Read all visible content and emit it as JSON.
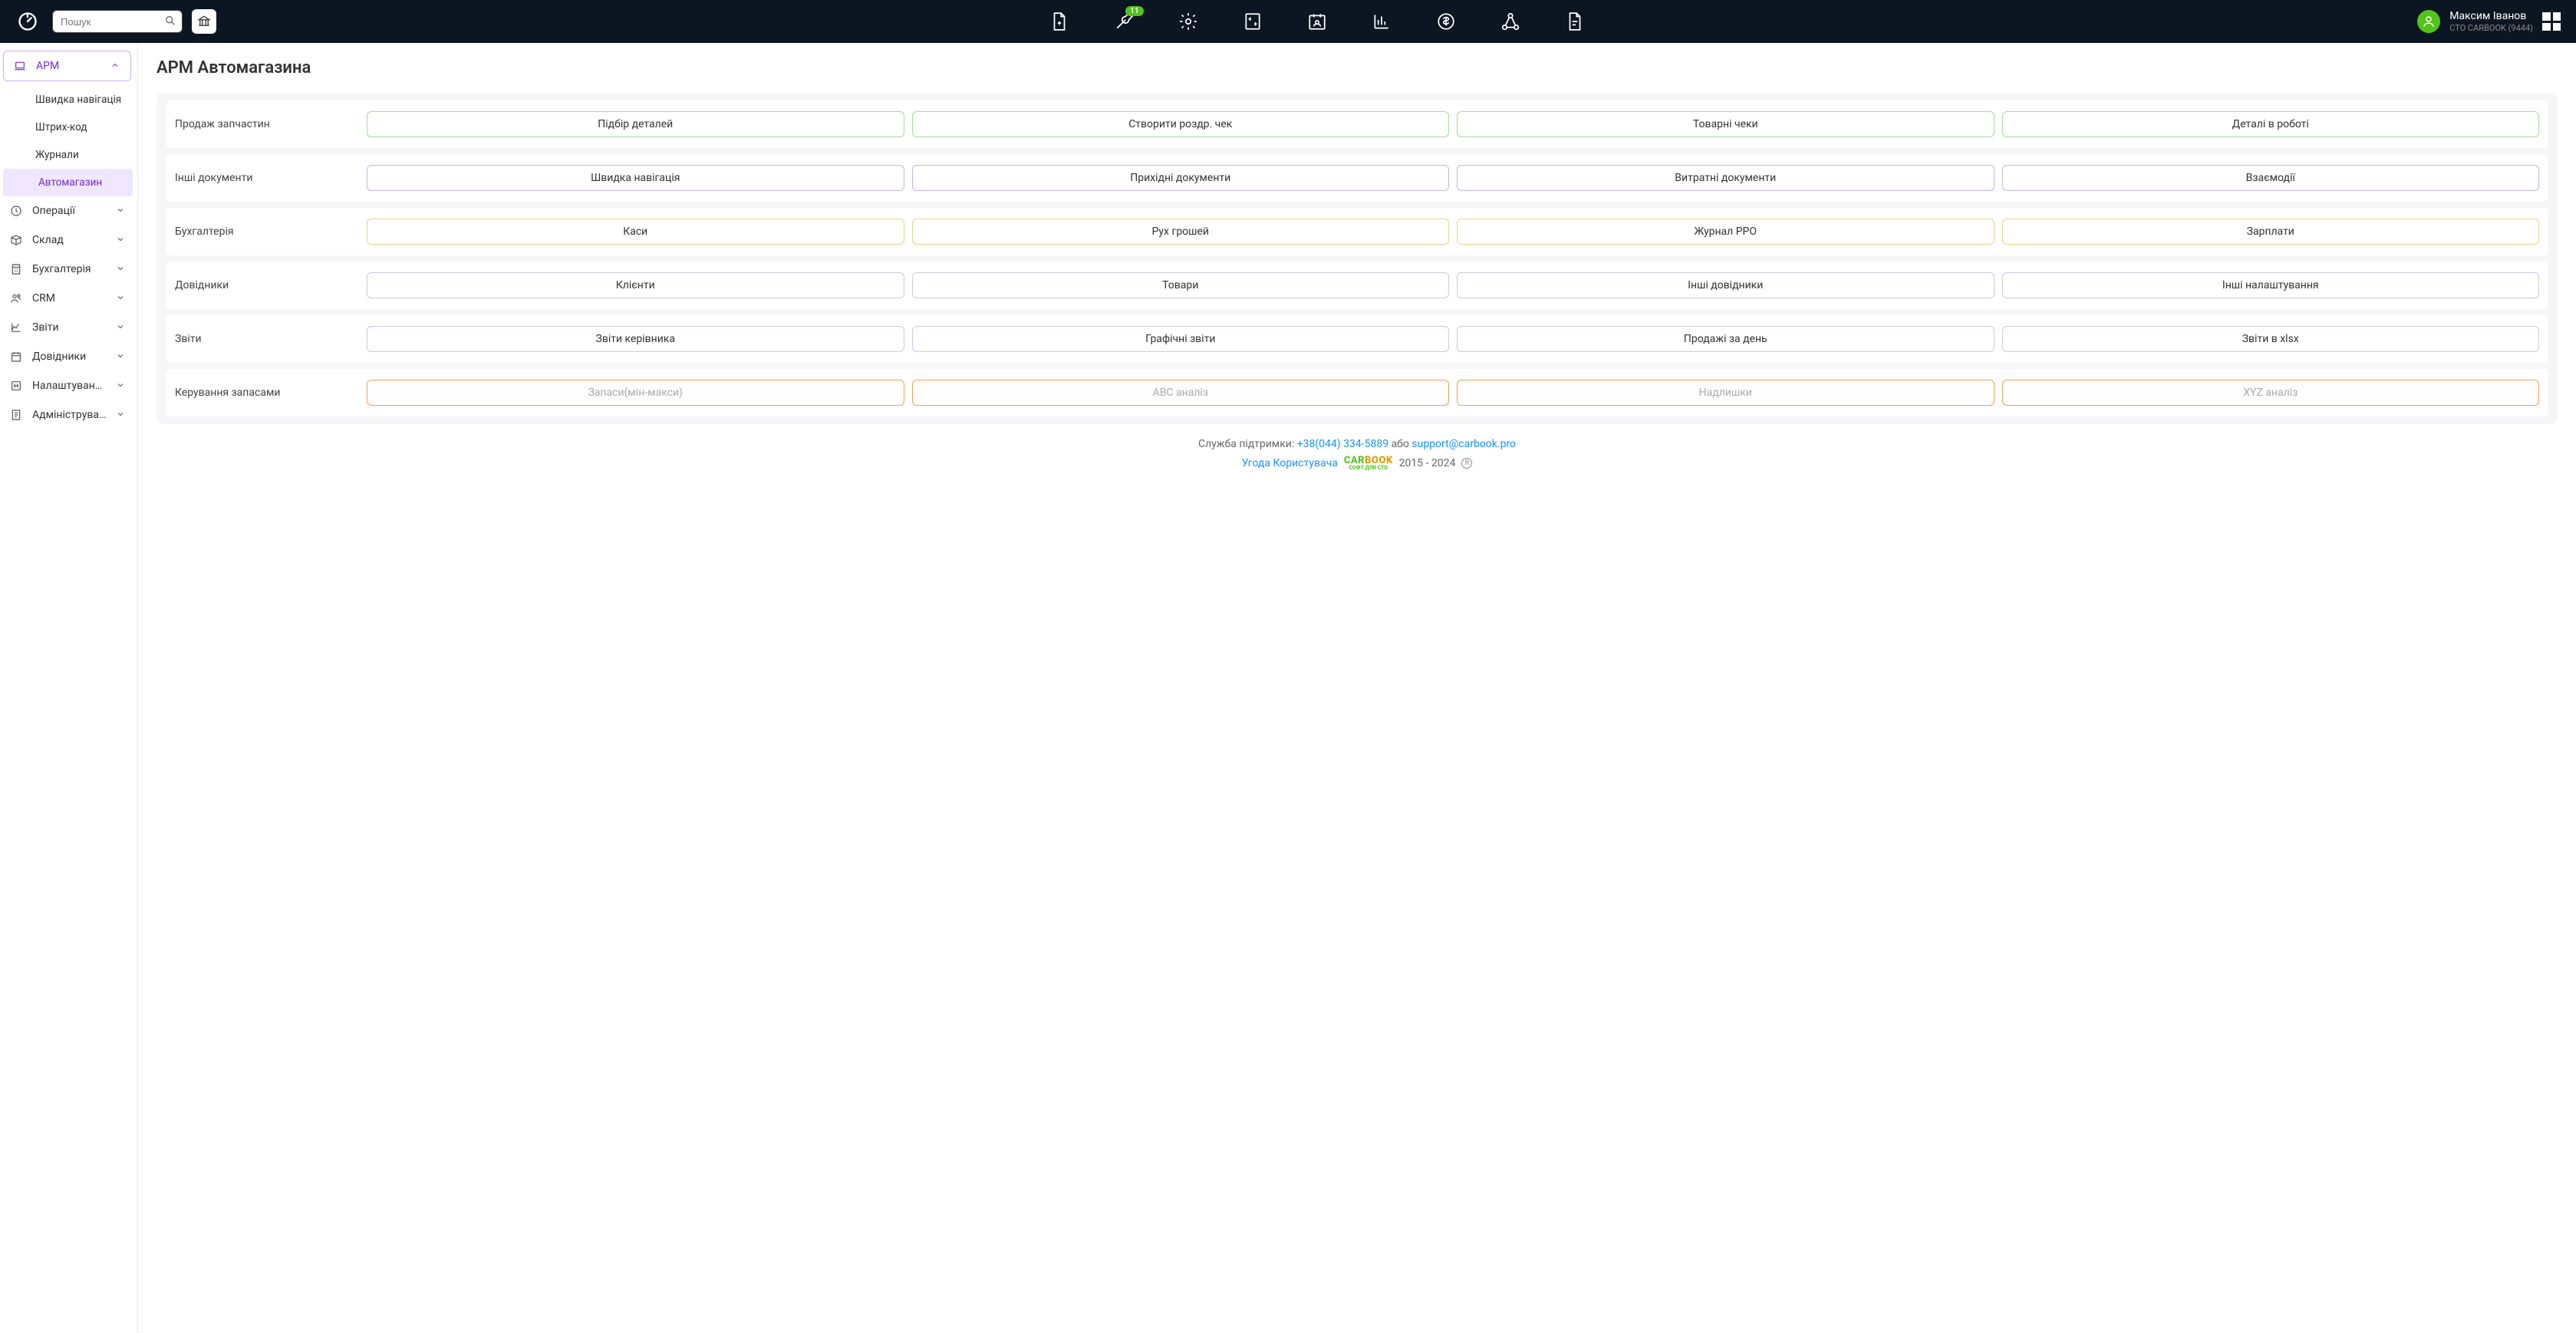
{
  "header": {
    "search_placeholder": "Пошук",
    "badge_count": "11",
    "user_name": "Максим Іванов",
    "user_org": "СТО CARBOOK (9444)"
  },
  "sidebar": {
    "arm_label": "АРМ",
    "sub_quick_nav": "Швидка навігація",
    "sub_barcode": "Штрих-код",
    "sub_journals": "Журнали",
    "sub_autoshop": "Автомагазин",
    "items": [
      {
        "label": "Операції"
      },
      {
        "label": "Склад"
      },
      {
        "label": "Бухгалтерія"
      },
      {
        "label": "CRM"
      },
      {
        "label": "Звіти"
      },
      {
        "label": "Довідники"
      },
      {
        "label": "Налаштування"
      },
      {
        "label": "Адміністрування"
      }
    ]
  },
  "page": {
    "title": "АРМ Автомагазина",
    "sections": [
      {
        "label": "Продаж запчастин",
        "cls": "b-green",
        "buttons": [
          "Підбір деталей",
          "Створити роздр. чек",
          "Товарні чеки",
          "Деталі в роботі"
        ]
      },
      {
        "label": "Інші документи",
        "cls": "b-purple",
        "buttons": [
          "Швидка навігація",
          "Прихідні документи",
          "Витратні документи",
          "Взаємодії"
        ]
      },
      {
        "label": "Бухгалтерія",
        "cls": "b-yellow",
        "buttons": [
          "Каси",
          "Рух грошей",
          "Журнал РРО",
          "Зарплати"
        ]
      },
      {
        "label": "Довідники",
        "cls": "b-lightpurple",
        "buttons": [
          "Клієнти",
          "Товари",
          "Інші довідники",
          "Інші налаштування"
        ]
      },
      {
        "label": "Звіти",
        "cls": "b-lightpurple",
        "buttons": [
          "Звіти керівника",
          "Графічні звіти",
          "Продажі за день",
          "Звіти в xlsx"
        ]
      },
      {
        "label": "Керування запасами",
        "cls": "b-orange",
        "disabled": true,
        "buttons": [
          "Запаси(мін-макси)",
          "ABC аналіз",
          "Надлишки",
          "XYZ аналіз"
        ]
      }
    ]
  },
  "footer": {
    "support_label": "Служба підтримки: ",
    "phone": "+38(044) 334-5889",
    "or": " або ",
    "email": "support@carbook.pro",
    "agreement": "Угода Користувача",
    "years": "2015 - 2024"
  }
}
